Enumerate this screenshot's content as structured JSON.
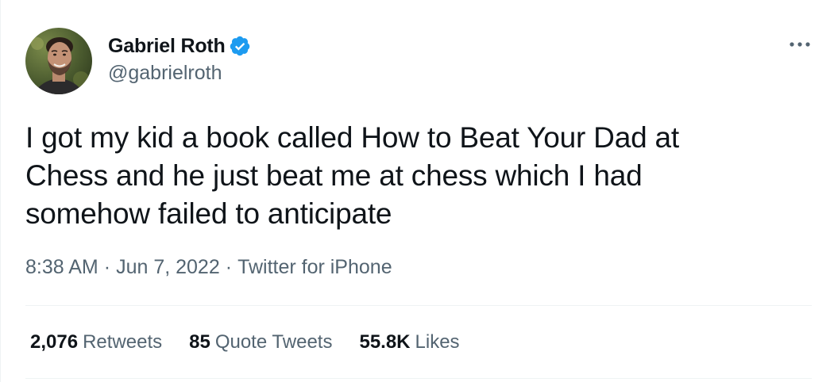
{
  "author": {
    "name": "Gabriel Roth",
    "handle": "@gabrielroth",
    "verified": true,
    "avatar_icon": "profile-photo"
  },
  "more_icon": "more-horizontal-icon",
  "tweet": {
    "text": "I got my kid a book called How to Beat Your Dad at\nChess and he just beat me at chess which I had\nsomehow failed to anticipate",
    "time": "8:38 AM",
    "separator": "·",
    "date": "Jun 7, 2022",
    "source": "Twitter for iPhone"
  },
  "stats": {
    "retweets": {
      "count": "2,076",
      "label": "Retweets"
    },
    "quote_tweets": {
      "count": "85",
      "label": "Quote Tweets"
    },
    "likes": {
      "count": "55.8K",
      "label": "Likes"
    }
  },
  "colors": {
    "text": "#0f1419",
    "secondary": "#536471",
    "verified": "#1d9bf0",
    "divider": "#eff3f4"
  }
}
